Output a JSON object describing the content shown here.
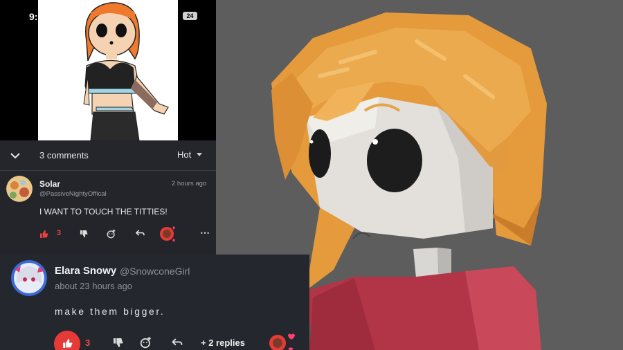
{
  "status_bar": {
    "time": "9:",
    "battery": "24"
  },
  "comments_header": {
    "count_label": "3 comments",
    "sort_label": "Hot",
    "collapse_icon": "chevron-down-icon"
  },
  "comment_1": {
    "name": "Solar",
    "handle": "@PassiveNightyOffical",
    "time": "2 hours ago",
    "body": "I WANT TO TOUCH THE TITTIES!",
    "like_count": "3",
    "icons": [
      "thumbs-up-icon",
      "thumbs-down-icon",
      "add-reaction-icon",
      "reply-icon",
      "creator-heart-icon",
      "more-icon"
    ]
  },
  "comment_2": {
    "name": "Elara Snowy",
    "handle": "@SnowconeGirl",
    "time": "about 23 hours ago",
    "body": "make them bigger.",
    "like_count": "3",
    "replies_label": "+ 2 replies",
    "icons": [
      "thumbs-up-icon",
      "thumbs-down-icon",
      "add-reaction-icon",
      "reply-icon",
      "creator-heart-icon"
    ]
  },
  "colors": {
    "accent_red": "#e53a35",
    "panel_bg": "#24272e",
    "hair_orange": "#ecaa4e",
    "sweater_red": "#b83849"
  }
}
